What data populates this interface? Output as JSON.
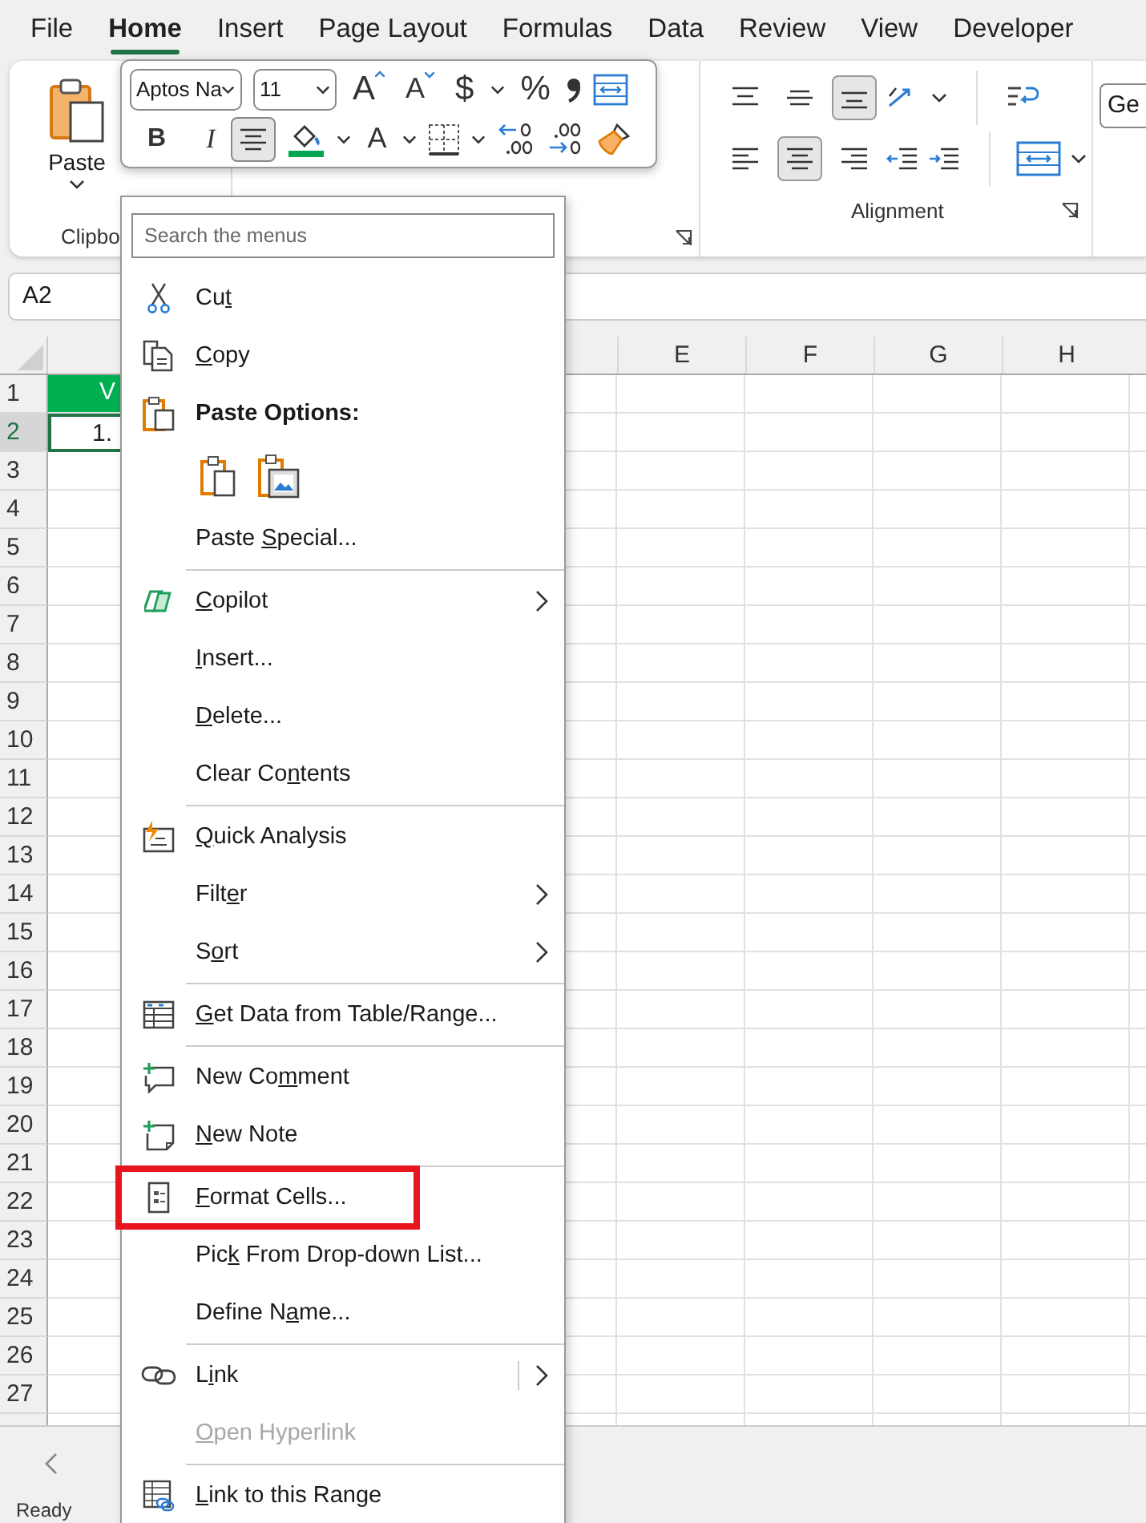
{
  "tabs": [
    {
      "label": "File",
      "selected": false
    },
    {
      "label": "Home",
      "selected": true
    },
    {
      "label": "Insert",
      "selected": false
    },
    {
      "label": "Page Layout",
      "selected": false
    },
    {
      "label": "Formulas",
      "selected": false
    },
    {
      "label": "Data",
      "selected": false
    },
    {
      "label": "Review",
      "selected": false
    },
    {
      "label": "View",
      "selected": false
    },
    {
      "label": "Developer",
      "selected": false
    }
  ],
  "ribbon": {
    "clipboard": {
      "paste_label": "Paste",
      "group_label": "Clipbo"
    },
    "alignment": {
      "group_label": "Alignment",
      "vertical": [
        {
          "selected": false
        },
        {
          "selected": false
        },
        {
          "selected": true
        }
      ],
      "horizontal": [
        {
          "selected": false
        },
        {
          "selected": true
        },
        {
          "selected": false
        }
      ]
    },
    "number_format": "Ge"
  },
  "mini_toolbar": {
    "font": "Aptos Na",
    "size": "11",
    "grow_font": "A",
    "shrink_font": "A",
    "currency": "$",
    "percent": "%",
    "bold": "B",
    "italic": "I",
    "font_color": "A",
    "center_align": {
      "selected": true
    }
  },
  "name_box": "A2",
  "column_headers": [
    "E",
    "F",
    "G",
    "H"
  ],
  "rows": [
    {
      "header": "1",
      "selected": false,
      "cell_a": {
        "kind": "header_cell",
        "text": "V"
      }
    },
    {
      "header": "2",
      "selected": true,
      "cell_a": {
        "kind": "value",
        "text": "1."
      }
    },
    {
      "header": "3",
      "selected": false
    },
    {
      "header": "4",
      "selected": false
    },
    {
      "header": "5",
      "selected": false
    },
    {
      "header": "6",
      "selected": false
    },
    {
      "header": "7",
      "selected": false
    },
    {
      "header": "8",
      "selected": false
    },
    {
      "header": "9",
      "selected": false
    },
    {
      "header": "10",
      "selected": false
    },
    {
      "header": "11",
      "selected": false
    },
    {
      "header": "12",
      "selected": false
    },
    {
      "header": "13",
      "selected": false
    },
    {
      "header": "14",
      "selected": false
    },
    {
      "header": "15",
      "selected": false
    },
    {
      "header": "16",
      "selected": false
    },
    {
      "header": "17",
      "selected": false
    },
    {
      "header": "18",
      "selected": false
    },
    {
      "header": "19",
      "selected": false
    },
    {
      "header": "20",
      "selected": false
    },
    {
      "header": "21",
      "selected": false
    },
    {
      "header": "22",
      "selected": false
    },
    {
      "header": "23",
      "selected": false
    },
    {
      "header": "24",
      "selected": false
    },
    {
      "header": "25",
      "selected": false
    },
    {
      "header": "26",
      "selected": false
    },
    {
      "header": "27",
      "selected": false
    }
  ],
  "context_menu": {
    "search": {
      "placeholder": "Search the menus"
    },
    "items": [
      {
        "kind": "item",
        "label": "Cut",
        "submenu": false,
        "disabled": false,
        "highlighted": false
      },
      {
        "kind": "item",
        "label": "Copy",
        "submenu": false,
        "disabled": false,
        "highlighted": false
      },
      {
        "kind": "heading",
        "label": "Paste Options:"
      },
      {
        "kind": "paste_options"
      },
      {
        "kind": "item",
        "label": "Paste Special...",
        "submenu": false,
        "disabled": false,
        "highlighted": false
      },
      {
        "kind": "separator"
      },
      {
        "kind": "item",
        "label": "Copilot",
        "submenu": true,
        "disabled": false,
        "highlighted": false
      },
      {
        "kind": "item",
        "label": "Insert...",
        "submenu": false,
        "disabled": false,
        "highlighted": false
      },
      {
        "kind": "item",
        "label": "Delete...",
        "submenu": false,
        "disabled": false,
        "highlighted": false
      },
      {
        "kind": "item",
        "label": "Clear Contents",
        "submenu": false,
        "disabled": false,
        "highlighted": false
      },
      {
        "kind": "separator"
      },
      {
        "kind": "item",
        "label": "Quick Analysis",
        "submenu": false,
        "disabled": false,
        "highlighted": false
      },
      {
        "kind": "item",
        "label": "Filter",
        "submenu": true,
        "disabled": false,
        "highlighted": false
      },
      {
        "kind": "item",
        "label": "Sort",
        "submenu": true,
        "disabled": false,
        "highlighted": false
      },
      {
        "kind": "separator"
      },
      {
        "kind": "item",
        "label": "Get Data from Table/Range...",
        "submenu": false,
        "disabled": false,
        "highlighted": false
      },
      {
        "kind": "separator"
      },
      {
        "kind": "item",
        "label": "New Comment",
        "submenu": false,
        "disabled": false,
        "highlighted": false
      },
      {
        "kind": "item",
        "label": "New Note",
        "submenu": false,
        "disabled": false,
        "highlighted": false
      },
      {
        "kind": "separator"
      },
      {
        "kind": "item",
        "label": "Format Cells...",
        "submenu": false,
        "disabled": false,
        "highlighted": true
      },
      {
        "kind": "item",
        "label": "Pick From Drop-down List...",
        "submenu": false,
        "disabled": false,
        "highlighted": false
      },
      {
        "kind": "item",
        "label": "Define Name...",
        "submenu": false,
        "disabled": false,
        "highlighted": false
      },
      {
        "kind": "separator"
      },
      {
        "kind": "item",
        "label": "Link",
        "submenu": true,
        "disabled": false,
        "highlighted": false
      },
      {
        "kind": "item",
        "label": "Open Hyperlink",
        "submenu": false,
        "disabled": true,
        "highlighted": false
      },
      {
        "kind": "separator"
      },
      {
        "kind": "item",
        "label": "Link to this Range",
        "submenu": false,
        "disabled": false,
        "highlighted": false
      }
    ]
  },
  "status_bar": {
    "text": "Ready"
  }
}
